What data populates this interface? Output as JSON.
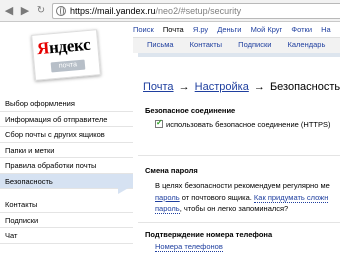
{
  "browser": {
    "url_host": "https://mail.yandex.ru",
    "url_path": "/neo2/#setup/security"
  },
  "logo": {
    "first_letter": "Я",
    "rest": "ндекс",
    "subtitle": "почта"
  },
  "services": [
    "Поиск",
    "Почта",
    "Я.ру",
    "Деньги",
    "Мой Круг",
    "Фотки",
    "На"
  ],
  "subtabs": [
    "Письма",
    "Контакты",
    "Подписки",
    "Календарь"
  ],
  "breadcrumb": {
    "mail": "Почта",
    "settings": "Настройка",
    "current": "Безопасность",
    "sep": "→"
  },
  "sidebar": {
    "items": [
      "Выбор оформления",
      "Информация об отправителе",
      "Сбор почты с других ящиков",
      "Папки и метки",
      "Правила обработки почты",
      "Безопасность"
    ],
    "items2": [
      "Контакты",
      "Подписки",
      "Чат"
    ]
  },
  "security": {
    "conn_heading": "Безопасное соединение",
    "https_label": "использовать безопасное соединение (HTTPS)",
    "https_checked": true,
    "pwd_heading": "Смена пароля",
    "pwd_line1": "В целях безопасности рекомендуем регулярно ме",
    "pwd_line2_link": "пароль",
    "pwd_line2_text": " от почтового ящика. ",
    "pwd_line2_hint": "Как придумать сложн",
    "pwd_line3_link": "пароль",
    "pwd_line3_text": ", чтобы он легко запоминался?",
    "phone_heading": "Подтверждение номера телефона",
    "phone_link": "Номера телефонов"
  }
}
